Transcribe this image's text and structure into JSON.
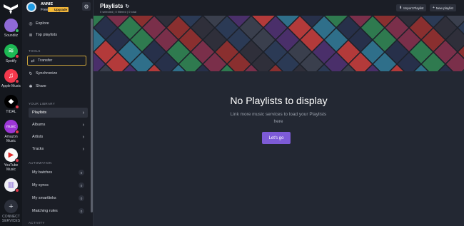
{
  "services": [
    {
      "label": "Soundiiz",
      "icon": "soundiiz-icon",
      "color": "#8f6ad6",
      "glyph": "",
      "dot": "green"
    },
    {
      "label": "Spotify",
      "icon": "spotify-icon",
      "color": "#1db954",
      "glyph": "≋",
      "dot": "red"
    },
    {
      "label": "Apple Music",
      "icon": "apple-music-icon",
      "color": "#f3384c",
      "glyph": "♫",
      "dot": "red"
    },
    {
      "label": "TIDAL",
      "icon": "tidal-icon",
      "color": "#000000",
      "glyph": "◆",
      "dot": "red"
    },
    {
      "label": "Amazon\nMusic",
      "icon": "amazon-music-icon",
      "color": "#9c36d6",
      "glyph": "music",
      "dot": "red"
    },
    {
      "label": "YouTube\nMusic",
      "icon": "youtube-music-icon",
      "color": "#f9f9f9",
      "glyph": "▶",
      "dot": "red"
    },
    {
      "label": "",
      "icon": "charts-icon",
      "color": "#f0f0f4",
      "glyph": "▥",
      "dot": "red"
    }
  ],
  "connect_label": "CONNECT\nSERVICES",
  "user": {
    "name": "ANNIE",
    "plan": "Free",
    "upgrade": "⚡ Upgrade"
  },
  "nav": {
    "explore": "Explore",
    "top_playlists": "Top playlists"
  },
  "tools": {
    "title": "TOOLS",
    "transfer": "Transfer",
    "synchronize": "Synchronize",
    "share": "Share"
  },
  "library": {
    "title": "YOUR LIBRARY",
    "items": [
      {
        "label": "Playlists",
        "active": true
      },
      {
        "label": "Albums",
        "active": false
      },
      {
        "label": "Artists",
        "active": false
      },
      {
        "label": "Tracks",
        "active": false
      }
    ]
  },
  "automation": {
    "title": "AUTOMATION",
    "items": [
      {
        "label": "My batches",
        "count": "0"
      },
      {
        "label": "My syncs",
        "count": "0"
      },
      {
        "label": "My smartlinks",
        "count": "0"
      },
      {
        "label": "Matching rules",
        "count": "0"
      }
    ]
  },
  "activity": {
    "title": "ACTIVITY"
  },
  "header": {
    "title": "Playlists",
    "subtitle": "0 selected | 0 filtered | 0 total",
    "import_label": "Import Playlist",
    "new_label": "New playlist"
  },
  "empty_state": {
    "title": "No Playlists to display",
    "subtitle": "Link more music services to load your Playlists here",
    "cta": "Let's go"
  },
  "colors": {
    "accent": "#7d5bd6",
    "sidebar": "#1b1e26",
    "main": "#232833"
  }
}
